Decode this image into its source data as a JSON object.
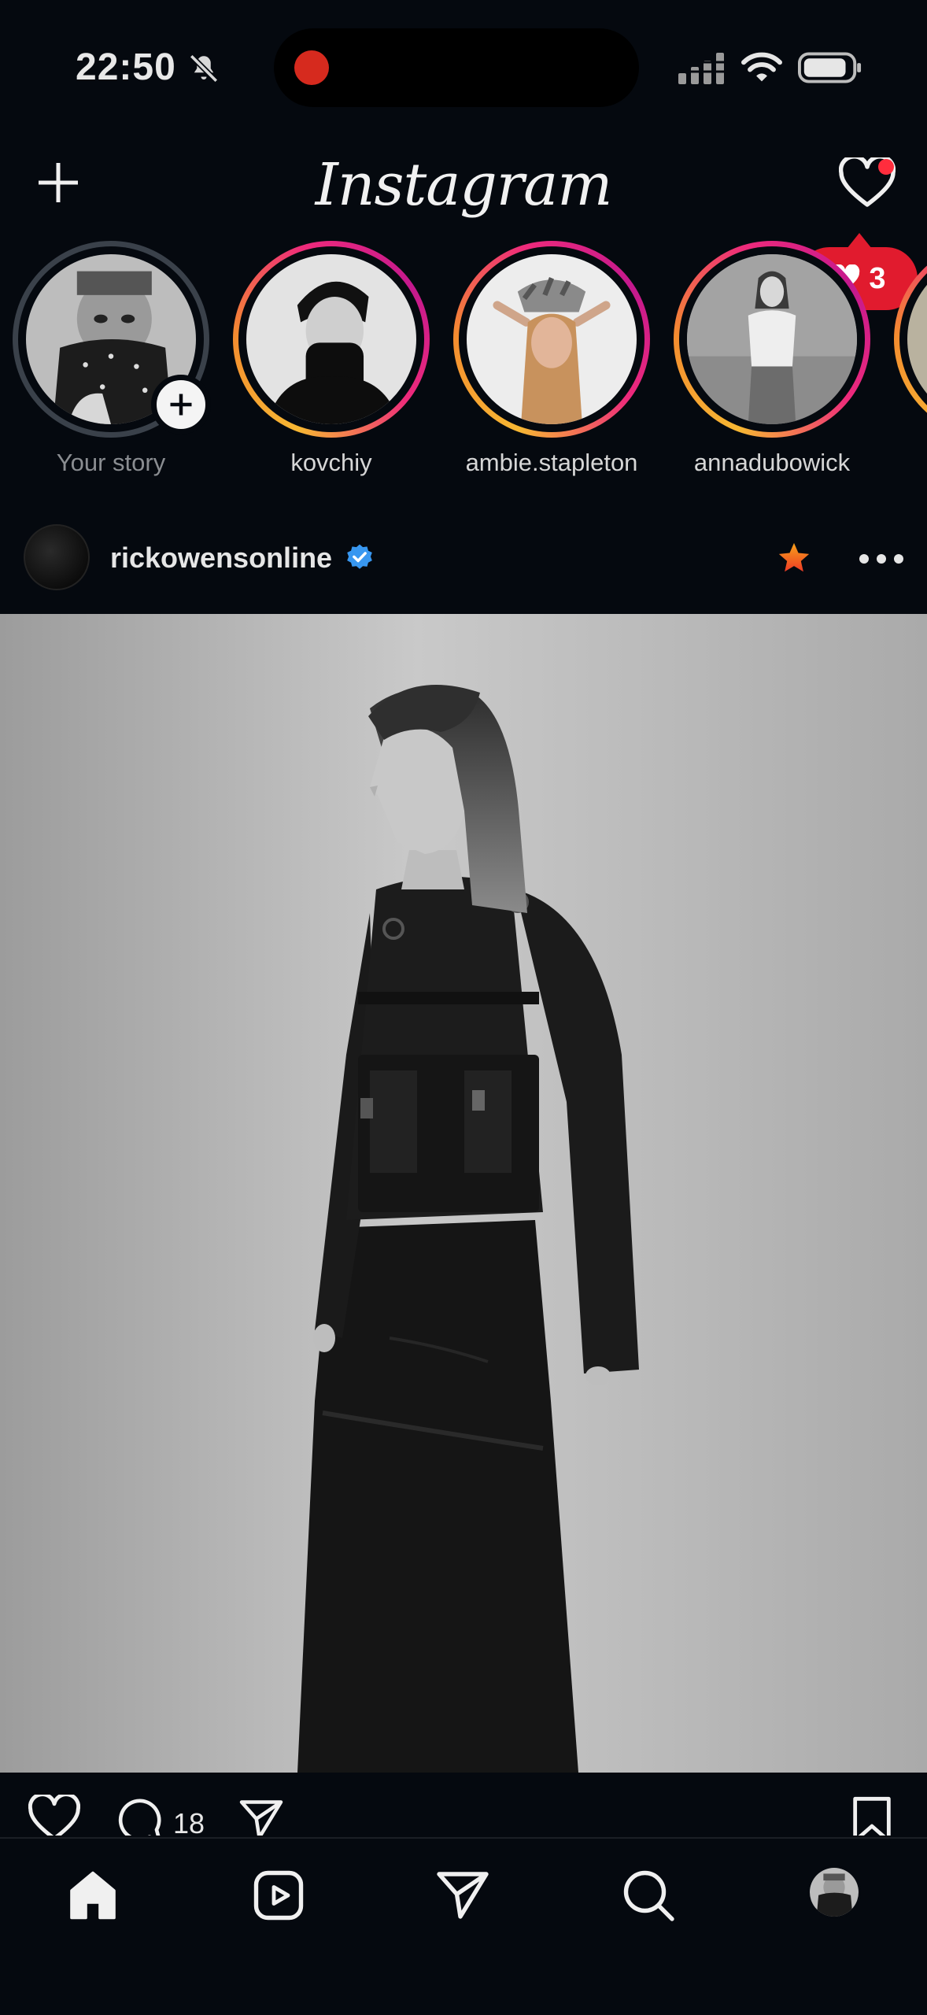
{
  "status_bar": {
    "time": "22:50",
    "icons": [
      "bell-slash-icon",
      "signal-icon",
      "wifi-icon",
      "battery-icon"
    ]
  },
  "header": {
    "logo": "Instagram",
    "icons": [
      "plus-icon",
      "heart-icon"
    ],
    "activity_count": "3"
  },
  "stories": [
    {
      "username": "Your story",
      "seen": true,
      "is_own": true
    },
    {
      "username": "kovchiy",
      "seen": false
    },
    {
      "username": "ambie.stapleton",
      "seen": false
    },
    {
      "username": "annadubowick",
      "seen": false
    }
  ],
  "post": {
    "username": "rickowensonline",
    "verified": true,
    "favorite_icon": "star-icon",
    "more_icon": "more-horizontal-icon",
    "comment_count": "18",
    "action_icons": [
      "heart-icon",
      "comment-icon",
      "send-icon",
      "bookmark-icon"
    ]
  },
  "tab_bar": {
    "items": [
      "home-icon",
      "reels-icon",
      "send-icon",
      "search-icon",
      "profile-avatar"
    ]
  },
  "colors": {
    "background": "#05090f",
    "notification_red": "#e11b2e",
    "verified_blue": "#3897f0",
    "favorite_orange": "#f04e23"
  }
}
